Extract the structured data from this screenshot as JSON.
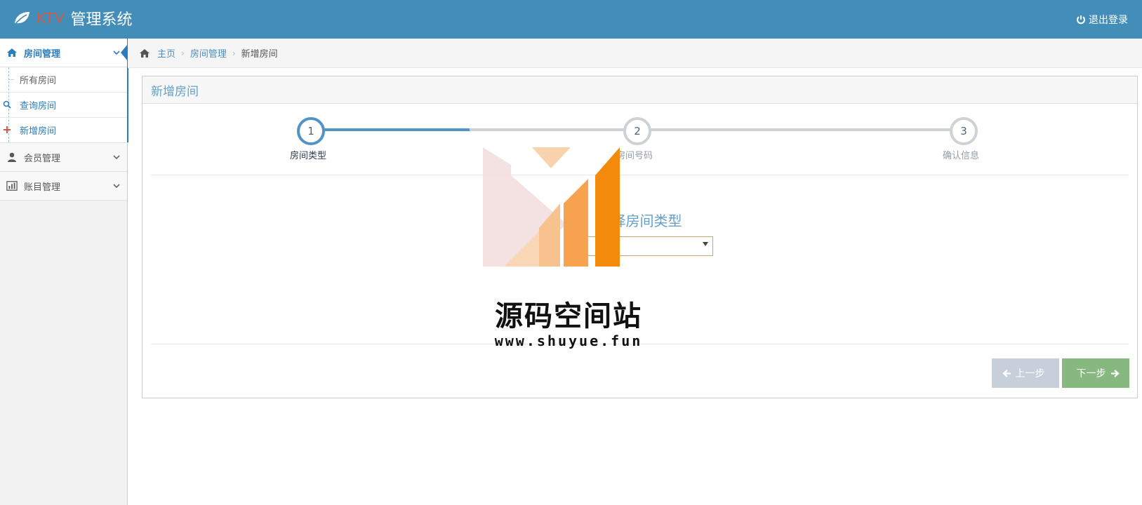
{
  "header": {
    "brand_prefix": "KTV",
    "brand_title": "管理系统",
    "logout_label": "退出登录"
  },
  "sidebar": {
    "items": [
      {
        "label": "房间管理",
        "icon": "home-icon",
        "expanded": true,
        "children": [
          {
            "label": "所有房间"
          },
          {
            "label": "查询房间",
            "icon": "search-icon"
          },
          {
            "label": "新增房间",
            "icon": "plus-icon"
          }
        ]
      },
      {
        "label": "会员管理",
        "icon": "user-icon"
      },
      {
        "label": "账目管理",
        "icon": "bar-chart-icon"
      }
    ]
  },
  "breadcrumbs": {
    "home": "主页",
    "section": "房间管理",
    "current": "新增房间"
  },
  "widget": {
    "title": "新增房间",
    "steps": [
      {
        "number": "1",
        "title": "房间类型",
        "active": true
      },
      {
        "number": "2",
        "title": "房间号码",
        "active": false
      },
      {
        "number": "3",
        "title": "确认信息",
        "active": false
      }
    ],
    "form_title": "选择房间类型",
    "select_value": "",
    "prev_label": "上一步",
    "next_label": "下一步"
  },
  "watermark": {
    "text": "源码空间站",
    "url": "www.shuyue.fun"
  },
  "colors": {
    "navbar": "#438eb9",
    "accent": "#2b7dbc",
    "step_active": "#5293c4",
    "next_button": "#87b87f",
    "prev_button": "#c7d0da"
  }
}
